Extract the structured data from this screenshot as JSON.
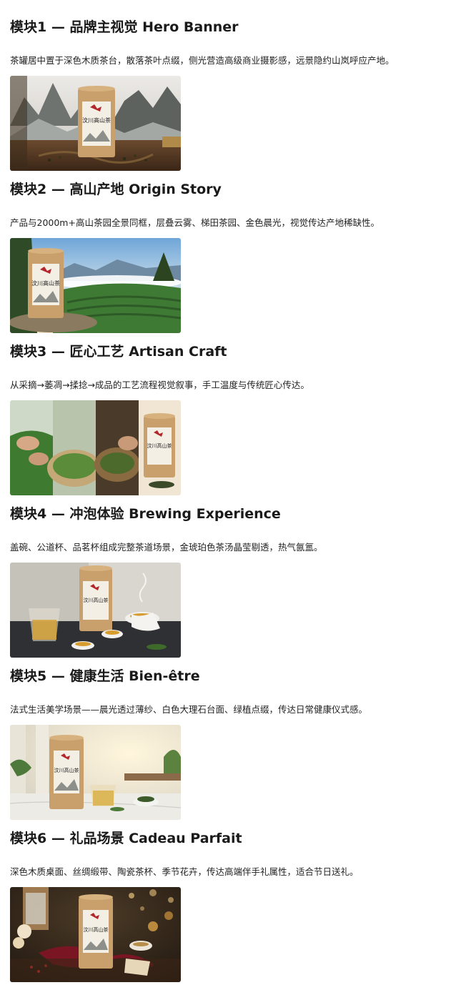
{
  "modules": [
    {
      "title": "模块1 — 品牌主视觉 Hero Banner",
      "desc": "茶罐居中置于深色木质茶台，散落茶叶点缀，侧光营造高级商业摄影感，远景隐约山岚呼应产地。",
      "image": "tea-canister-on-wooden-table-with-misty-mountains"
    },
    {
      "title": "模块2 — 高山产地 Origin Story",
      "desc": "产品与2000m+高山茶园全景同框，层叠云雾、梯田茶园、金色晨光，视觉传达产地稀缺性。",
      "image": "tea-canister-on-rock-with-terraced-tea-garden"
    },
    {
      "title": "模块3 — 匠心工艺 Artisan Craft",
      "desc": "从采摘→萎凋→揉捻→成品的工艺流程视觉叙事，手工温度与传统匠心传达。",
      "image": "tea-processing-steps-collage"
    },
    {
      "title": "模块4 — 冲泡体验 Brewing Experience",
      "desc": "盖碗、公道杯、品茗杯组成完整茶道场景，金琥珀色茶汤晶莹剔透，热气氤氲。",
      "image": "tea-brewing-set-with-canister"
    },
    {
      "title": "模块5 — 健康生活 Bien-être",
      "desc": "法式生活美学场景——晨光透过薄纱、白色大理石台面、绿植点缀，传达日常健康仪式感。",
      "image": "canister-on-marble-with-tea-cup"
    },
    {
      "title": "模块6 — 礼品场景 Cadeau Parfait",
      "desc": "深色木质桌面、丝绸缎带、陶瓷茶杯、季节花卉，传达高端伴手礼属性，适合节日送礼。",
      "image": "gift-scene-with-ribbon-and-ornaments"
    }
  ],
  "canister_label": "汶川高山茶",
  "colors": {
    "canister": "#c9a06c",
    "label_bg": "#f4efe4",
    "red_mark": "#b3262b"
  }
}
